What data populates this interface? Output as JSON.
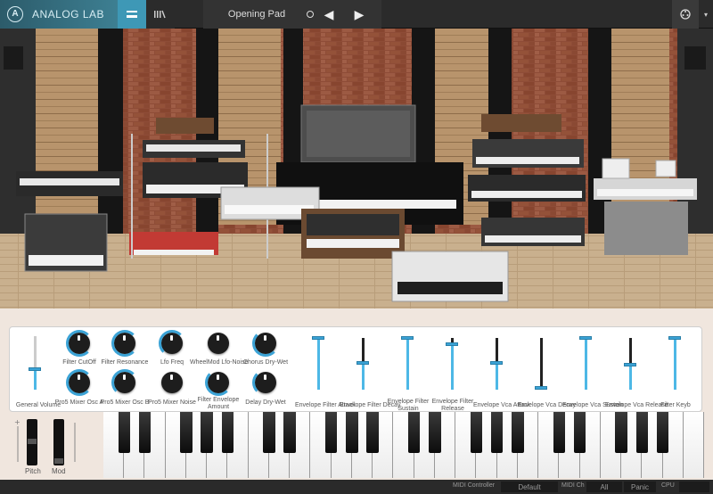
{
  "app": {
    "title": "ANALOG LAB",
    "logo_letter": "A"
  },
  "toolbar": {
    "preset_name": "Opening Pad",
    "prev_symbol": "◀",
    "next_symbol": "▶",
    "menu_symbol": "▾",
    "library_icon": "library-icon",
    "keyboard_view_icon": "keyboard-view-icon",
    "settings_icon": "settings-icon"
  },
  "knobs": [
    {
      "label": "Filter CutOff",
      "value": 0.65
    },
    {
      "label": "Filter Resonance",
      "value": 0.6
    },
    {
      "label": "Lfo Freq",
      "value": 0.55
    },
    {
      "label": "WheelMod Lfo-Noise",
      "value": 0.0
    },
    {
      "label": "Chorus Dry-Wet",
      "value": 0.5
    },
    {
      "label": "Pro5 Mixer Osc A",
      "value": 0.6
    },
    {
      "label": "Pro5 Mixer Osc B",
      "value": 0.55
    },
    {
      "label": "Pro5 Mixer Noise",
      "value": 0.0
    },
    {
      "label": "Filter Envelope Amount",
      "value": 0.4
    },
    {
      "label": "Delay Dry-Wet",
      "value": 0.35
    }
  ],
  "volume": {
    "label": "General Volume",
    "value": 0.45
  },
  "sliders": [
    {
      "label": "Envelope Filter Attack",
      "value": 1.0
    },
    {
      "label": "Envelope Filter Decay",
      "value": 0.5
    },
    {
      "label": "Envelope Filter Sustain",
      "value": 1.0
    },
    {
      "label": "Envelope Filter Release",
      "value": 0.9
    },
    {
      "label": "Envelope Vca Attack",
      "value": 0.5
    },
    {
      "label": "Envelope Vca Decay",
      "value": 0.0
    },
    {
      "label": "Envelope Vca Sustain",
      "value": 1.0
    },
    {
      "label": "Envelope Vca Release",
      "value": 0.45
    },
    {
      "label": "Filter Keyb",
      "value": 1.0
    }
  ],
  "wheels": {
    "pitch_label": "Pitch",
    "mod_label": "Mod"
  },
  "status": {
    "midi_controller_label": "MIDI Controller",
    "midi_controller_value": "Default",
    "midi_ch_label": "MIDI Ch",
    "midi_ch_value": "All",
    "panic_label": "Panic",
    "cpu_label": "CPU"
  },
  "colors": {
    "accent": "#3ba3d6",
    "topbar": "#2b2b2b",
    "panel_bg": "#f0e6de"
  }
}
